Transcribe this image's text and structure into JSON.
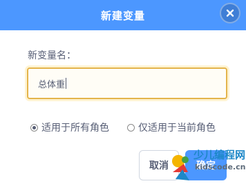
{
  "dialog": {
    "title": "新建变量",
    "close_icon": "close-icon",
    "field_label": "新变量名：",
    "input_value": "总体重",
    "options": [
      {
        "label": "适用于所有角色",
        "checked": true
      },
      {
        "label": "仅适用于当前角色",
        "checked": false
      }
    ],
    "cancel_label": "取消",
    "ok_label": "确定"
  },
  "watermark": {
    "line1": "少儿编程网",
    "line2": "kidscode.cn"
  },
  "colors": {
    "header": "#4c97ff",
    "input_border": "#e4b44b",
    "text": "#575e75"
  }
}
